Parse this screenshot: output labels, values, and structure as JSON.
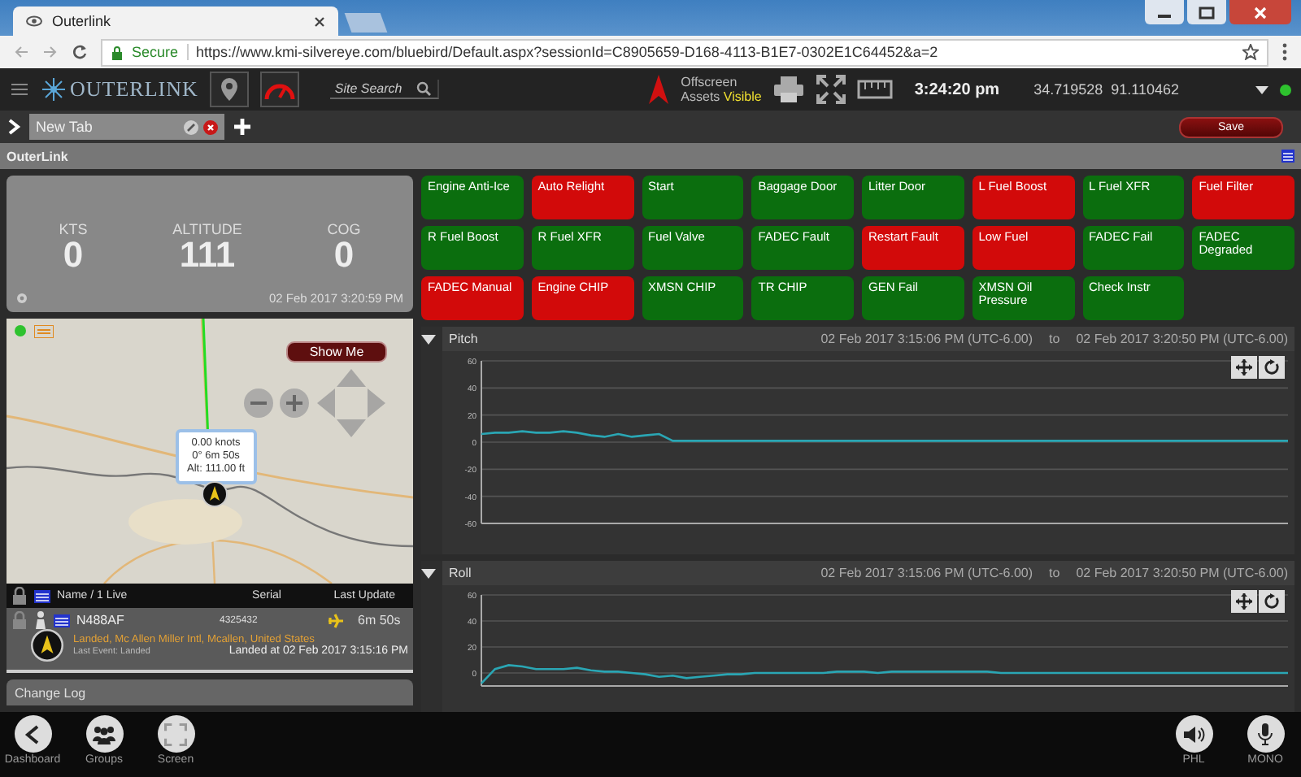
{
  "browser": {
    "tab_title": "Outerlink",
    "secure_label": "Secure",
    "url": "https://www.kmi-silvereye.com/bluebird/Default.aspx?sessionId=C8905659-D168-4113-B1E7-0302E1C64452&a=2"
  },
  "toolbar": {
    "brand": "OUTERLINK",
    "search_placeholder": "Site Search",
    "offscreen_label": "Offscreen",
    "assets_label": "Assets",
    "assets_status": "Visible",
    "time": "3:24:20 pm",
    "coordinates": "34.719528  91.110462"
  },
  "tabs": [
    {
      "label": "New Tab",
      "selected": true
    }
  ],
  "save_button": "Save",
  "section_title": "OuterLink",
  "telemetry": {
    "readouts": [
      {
        "label": "KTS",
        "value": "0"
      },
      {
        "label": "ALTITUDE",
        "value": "111"
      },
      {
        "label": "COG",
        "value": "0"
      }
    ],
    "timestamp": "02 Feb 2017 3:20:59 PM"
  },
  "alerts": [
    {
      "label": "Engine Anti-Ice",
      "color": "#0b6e0e"
    },
    {
      "label": "Auto Relight",
      "color": "#d20a0a"
    },
    {
      "label": "Start",
      "color": "#0b6e0e"
    },
    {
      "label": "Baggage Door",
      "color": "#0b6e0e"
    },
    {
      "label": "Litter Door",
      "color": "#0b6e0e"
    },
    {
      "label": "L Fuel Boost",
      "color": "#d20a0a"
    },
    {
      "label": "L Fuel XFR",
      "color": "#0b6e0e"
    },
    {
      "label": "Fuel Filter",
      "color": "#d20a0a"
    },
    {
      "label": "R Fuel Boost",
      "color": "#0b6e0e"
    },
    {
      "label": "R Fuel XFR",
      "color": "#0b6e0e"
    },
    {
      "label": "Fuel Valve",
      "color": "#0b6e0e"
    },
    {
      "label": "FADEC Fault",
      "color": "#0b6e0e"
    },
    {
      "label": "Restart Fault",
      "color": "#d20a0a"
    },
    {
      "label": "Low Fuel",
      "color": "#d20a0a"
    },
    {
      "label": "FADEC Fail",
      "color": "#0b6e0e"
    },
    {
      "label": "FADEC Degraded",
      "color": "#0b6e0e"
    },
    {
      "label": "FADEC Manual",
      "color": "#d20a0a"
    },
    {
      "label": "Engine CHIP",
      "color": "#d20a0a"
    },
    {
      "label": "XMSN CHIP",
      "color": "#0b6e0e"
    },
    {
      "label": "TR CHIP",
      "color": "#0b6e0e"
    },
    {
      "label": "GEN Fail",
      "color": "#0b6e0e"
    },
    {
      "label": "XMSN Oil Pressure",
      "color": "#0b6e0e"
    },
    {
      "label": "Check Instr",
      "color": "#0b6e0e"
    }
  ],
  "map": {
    "show_me_button": "Show Me",
    "popup_lines": [
      "0.00 knots",
      "0° 6m 50s",
      "Alt: 111.00 ft"
    ]
  },
  "asset_table": {
    "columns": [
      "Name / 1 Live",
      "Serial",
      "Last Update"
    ],
    "rows": [
      {
        "name": "N488AF",
        "serial": "4325432",
        "age": "6m 50s",
        "location": "Landed, Mc Allen Miller Intl, Mcallen, United States",
        "last_event": "Last Event: Landed",
        "status": "Landed at 02 Feb 2017 3:15:16 PM"
      }
    ]
  },
  "change_log": "Change Log",
  "charts": [
    {
      "title": "Pitch",
      "from": "02 Feb 2017 3:15:06 PM (UTC-6.00)",
      "to_word": "to",
      "to": "02 Feb 2017 3:20:50 PM (UTC-6.00)",
      "chart_data": {
        "type": "line",
        "grid": true,
        "ylim": [
          -60,
          60
        ],
        "yticks": [
          -60,
          -40,
          -20,
          0,
          20,
          40,
          60
        ],
        "series": [
          {
            "color": "#2aa6b4",
            "values": [
              6,
              7,
              7,
              8,
              7,
              7,
              8,
              7,
              5,
              4,
              6,
              4,
              5,
              6,
              1,
              1,
              1,
              1,
              1,
              1,
              1,
              1,
              1,
              1,
              1,
              1,
              1,
              1,
              1,
              1,
              1,
              1,
              1,
              1,
              1,
              1,
              1,
              1,
              1,
              1,
              1,
              1,
              1,
              1,
              1,
              1,
              1,
              1,
              1,
              1,
              1,
              1,
              1,
              1,
              1,
              1,
              1,
              1,
              1,
              1
            ]
          }
        ]
      }
    },
    {
      "title": "Roll",
      "from": "02 Feb 2017 3:15:06 PM (UTC-6.00)",
      "to_word": "to",
      "to": "02 Feb 2017 3:20:50 PM (UTC-6.00)",
      "chart_data": {
        "type": "line",
        "grid": true,
        "ylim": [
          -10,
          60
        ],
        "yticks": [
          0,
          20,
          40,
          60
        ],
        "series": [
          {
            "color": "#2aa6b4",
            "values": [
              -8,
              3,
              6,
              5,
              3,
              3,
              3,
              4,
              2,
              1,
              1,
              0,
              -1,
              -3,
              -2,
              -4,
              -3,
              -2,
              -1,
              -1,
              0,
              0,
              0,
              0,
              0,
              0,
              1,
              1,
              1,
              0,
              1,
              1,
              1,
              1,
              1,
              1,
              1,
              1,
              0,
              0,
              0,
              0,
              0,
              0,
              0,
              0,
              0,
              0,
              0,
              0,
              0,
              0,
              0,
              0,
              0,
              0,
              0,
              0,
              0,
              0
            ]
          }
        ]
      }
    }
  ],
  "bottom_left": [
    {
      "kind": "back",
      "label": "Dashboard"
    },
    {
      "kind": "groups",
      "label": "Groups"
    },
    {
      "kind": "screen",
      "label": "Screen"
    }
  ],
  "bottom_right": [
    {
      "kind": "speaker",
      "label": "PHL"
    },
    {
      "kind": "mic",
      "label": "MONO"
    }
  ]
}
